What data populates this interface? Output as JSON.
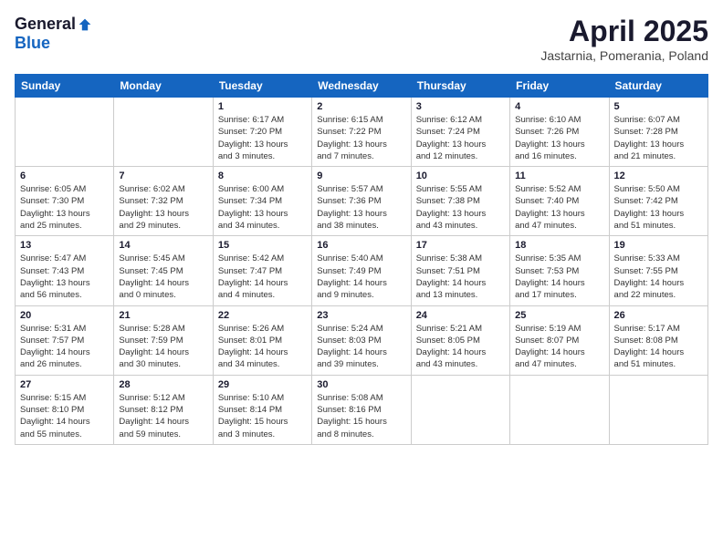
{
  "header": {
    "logo_general": "General",
    "logo_blue": "Blue",
    "month": "April 2025",
    "location": "Jastarnia, Pomerania, Poland"
  },
  "days_of_week": [
    "Sunday",
    "Monday",
    "Tuesday",
    "Wednesday",
    "Thursday",
    "Friday",
    "Saturday"
  ],
  "weeks": [
    [
      {
        "day": "",
        "detail": ""
      },
      {
        "day": "",
        "detail": ""
      },
      {
        "day": "1",
        "detail": "Sunrise: 6:17 AM\nSunset: 7:20 PM\nDaylight: 13 hours\nand 3 minutes."
      },
      {
        "day": "2",
        "detail": "Sunrise: 6:15 AM\nSunset: 7:22 PM\nDaylight: 13 hours\nand 7 minutes."
      },
      {
        "day": "3",
        "detail": "Sunrise: 6:12 AM\nSunset: 7:24 PM\nDaylight: 13 hours\nand 12 minutes."
      },
      {
        "day": "4",
        "detail": "Sunrise: 6:10 AM\nSunset: 7:26 PM\nDaylight: 13 hours\nand 16 minutes."
      },
      {
        "day": "5",
        "detail": "Sunrise: 6:07 AM\nSunset: 7:28 PM\nDaylight: 13 hours\nand 21 minutes."
      }
    ],
    [
      {
        "day": "6",
        "detail": "Sunrise: 6:05 AM\nSunset: 7:30 PM\nDaylight: 13 hours\nand 25 minutes."
      },
      {
        "day": "7",
        "detail": "Sunrise: 6:02 AM\nSunset: 7:32 PM\nDaylight: 13 hours\nand 29 minutes."
      },
      {
        "day": "8",
        "detail": "Sunrise: 6:00 AM\nSunset: 7:34 PM\nDaylight: 13 hours\nand 34 minutes."
      },
      {
        "day": "9",
        "detail": "Sunrise: 5:57 AM\nSunset: 7:36 PM\nDaylight: 13 hours\nand 38 minutes."
      },
      {
        "day": "10",
        "detail": "Sunrise: 5:55 AM\nSunset: 7:38 PM\nDaylight: 13 hours\nand 43 minutes."
      },
      {
        "day": "11",
        "detail": "Sunrise: 5:52 AM\nSunset: 7:40 PM\nDaylight: 13 hours\nand 47 minutes."
      },
      {
        "day": "12",
        "detail": "Sunrise: 5:50 AM\nSunset: 7:42 PM\nDaylight: 13 hours\nand 51 minutes."
      }
    ],
    [
      {
        "day": "13",
        "detail": "Sunrise: 5:47 AM\nSunset: 7:43 PM\nDaylight: 13 hours\nand 56 minutes."
      },
      {
        "day": "14",
        "detail": "Sunrise: 5:45 AM\nSunset: 7:45 PM\nDaylight: 14 hours\nand 0 minutes."
      },
      {
        "day": "15",
        "detail": "Sunrise: 5:42 AM\nSunset: 7:47 PM\nDaylight: 14 hours\nand 4 minutes."
      },
      {
        "day": "16",
        "detail": "Sunrise: 5:40 AM\nSunset: 7:49 PM\nDaylight: 14 hours\nand 9 minutes."
      },
      {
        "day": "17",
        "detail": "Sunrise: 5:38 AM\nSunset: 7:51 PM\nDaylight: 14 hours\nand 13 minutes."
      },
      {
        "day": "18",
        "detail": "Sunrise: 5:35 AM\nSunset: 7:53 PM\nDaylight: 14 hours\nand 17 minutes."
      },
      {
        "day": "19",
        "detail": "Sunrise: 5:33 AM\nSunset: 7:55 PM\nDaylight: 14 hours\nand 22 minutes."
      }
    ],
    [
      {
        "day": "20",
        "detail": "Sunrise: 5:31 AM\nSunset: 7:57 PM\nDaylight: 14 hours\nand 26 minutes."
      },
      {
        "day": "21",
        "detail": "Sunrise: 5:28 AM\nSunset: 7:59 PM\nDaylight: 14 hours\nand 30 minutes."
      },
      {
        "day": "22",
        "detail": "Sunrise: 5:26 AM\nSunset: 8:01 PM\nDaylight: 14 hours\nand 34 minutes."
      },
      {
        "day": "23",
        "detail": "Sunrise: 5:24 AM\nSunset: 8:03 PM\nDaylight: 14 hours\nand 39 minutes."
      },
      {
        "day": "24",
        "detail": "Sunrise: 5:21 AM\nSunset: 8:05 PM\nDaylight: 14 hours\nand 43 minutes."
      },
      {
        "day": "25",
        "detail": "Sunrise: 5:19 AM\nSunset: 8:07 PM\nDaylight: 14 hours\nand 47 minutes."
      },
      {
        "day": "26",
        "detail": "Sunrise: 5:17 AM\nSunset: 8:08 PM\nDaylight: 14 hours\nand 51 minutes."
      }
    ],
    [
      {
        "day": "27",
        "detail": "Sunrise: 5:15 AM\nSunset: 8:10 PM\nDaylight: 14 hours\nand 55 minutes."
      },
      {
        "day": "28",
        "detail": "Sunrise: 5:12 AM\nSunset: 8:12 PM\nDaylight: 14 hours\nand 59 minutes."
      },
      {
        "day": "29",
        "detail": "Sunrise: 5:10 AM\nSunset: 8:14 PM\nDaylight: 15 hours\nand 3 minutes."
      },
      {
        "day": "30",
        "detail": "Sunrise: 5:08 AM\nSunset: 8:16 PM\nDaylight: 15 hours\nand 8 minutes."
      },
      {
        "day": "",
        "detail": ""
      },
      {
        "day": "",
        "detail": ""
      },
      {
        "day": "",
        "detail": ""
      }
    ]
  ]
}
